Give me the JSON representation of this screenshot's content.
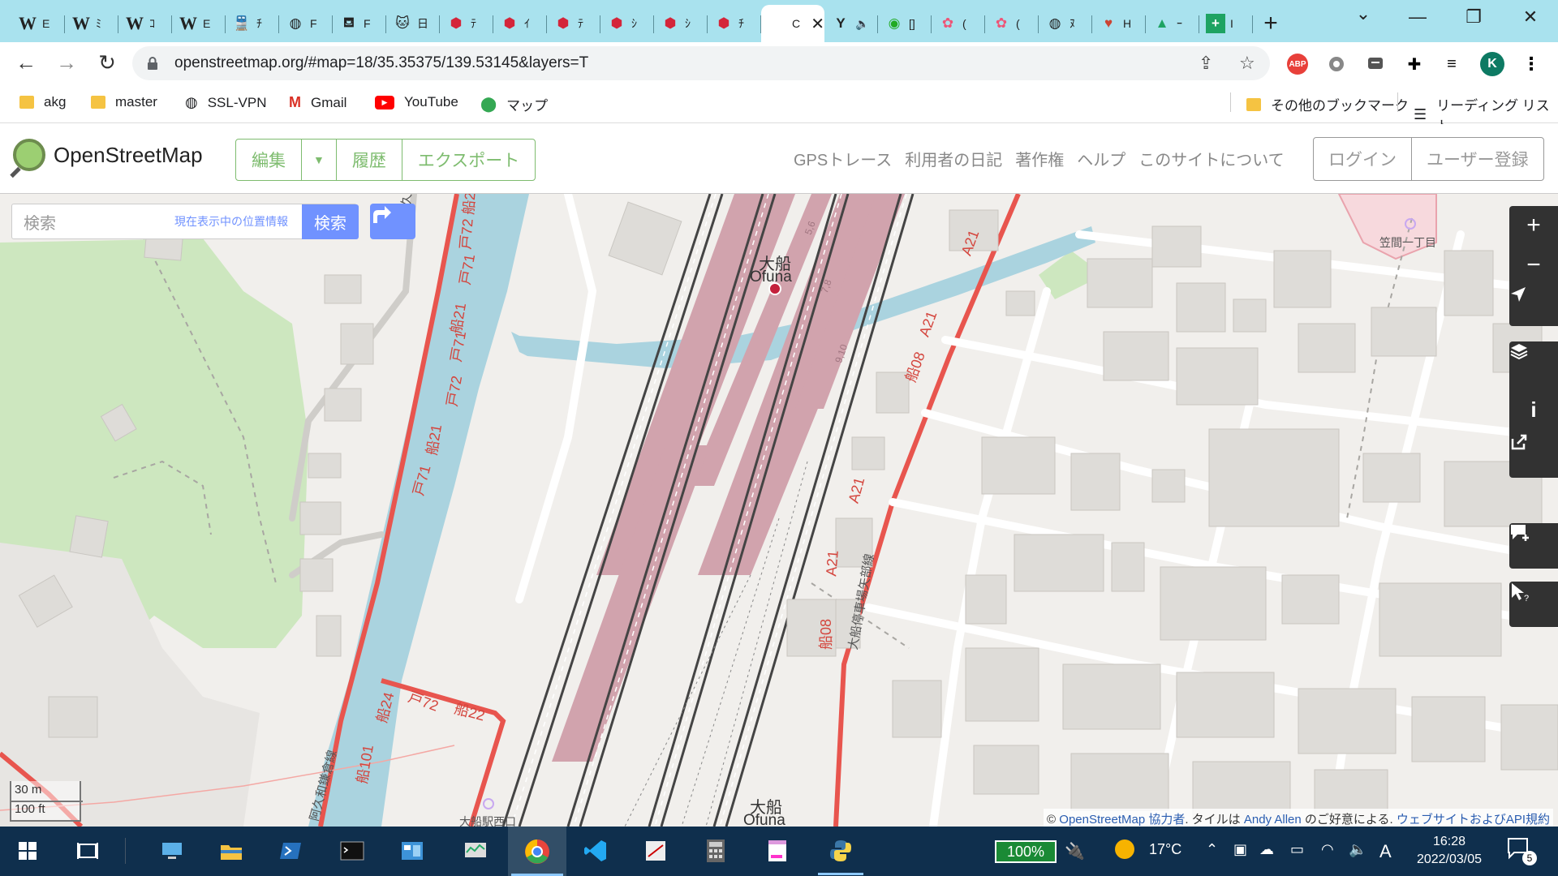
{
  "tabs": [
    {
      "icon": "wikipedia-icon",
      "glyph": "W",
      "label": "E"
    },
    {
      "icon": "wikipedia-icon",
      "glyph": "W",
      "label": "ﾐ"
    },
    {
      "icon": "wikipedia-icon",
      "glyph": "W",
      "label": "ｺ"
    },
    {
      "icon": "wikipedia-icon",
      "glyph": "W",
      "label": "E"
    },
    {
      "icon": "train-icon",
      "glyph": "🚆",
      "label": "ﾁ"
    },
    {
      "icon": "globe-icon",
      "glyph": "◍",
      "label": "F"
    },
    {
      "icon": "translate-icon",
      "glyph": "⛾",
      "label": "F"
    },
    {
      "icon": "cat-icon",
      "glyph": "🐱",
      "label": "日"
    },
    {
      "icon": "red-badge-icon",
      "glyph": "⬢",
      "label": "ﾃ"
    },
    {
      "icon": "red-badge-icon",
      "glyph": "⬢",
      "label": "ｲ"
    },
    {
      "icon": "red-badge-icon",
      "glyph": "⬢",
      "label": "ﾃ"
    },
    {
      "icon": "red-badge-icon",
      "glyph": "⬢",
      "label": "ｼ"
    },
    {
      "icon": "red-badge-icon",
      "glyph": "⬢",
      "label": "ｼ"
    },
    {
      "icon": "red-badge-icon",
      "glyph": "⬢",
      "label": "ﾁ"
    },
    {
      "icon": "osm-icon",
      "glyph": "",
      "label": "C",
      "active": true
    },
    {
      "icon": "youtube-icon",
      "glyph": "Y",
      "label": "🔈"
    },
    {
      "icon": "green-circle-icon",
      "glyph": "◉",
      "label": "[]"
    },
    {
      "icon": "photos-icon",
      "glyph": "✿",
      "label": "("
    },
    {
      "icon": "photos-icon",
      "glyph": "✿",
      "label": "("
    },
    {
      "icon": "globe-icon",
      "glyph": "◍",
      "label": "ﾇ"
    },
    {
      "icon": "heart-icon",
      "glyph": "♥",
      "label": "H"
    },
    {
      "icon": "drive-icon",
      "glyph": "▲",
      "label": "ｰ"
    },
    {
      "icon": "plus-green-icon",
      "glyph": "+",
      "label": "I"
    }
  ],
  "window": {
    "minimize": "—",
    "maximize": "❐",
    "close": "✕",
    "chevron": "⌄",
    "newtab": "+"
  },
  "address": {
    "url": "openstreetmap.org/#map=18/35.35375/139.53145&layers=T"
  },
  "bookmarks": [
    {
      "icon": "folder-icon",
      "label": "akg"
    },
    {
      "icon": "folder-icon",
      "label": "master"
    },
    {
      "icon": "globe-icon",
      "label": "SSL-VPN"
    },
    {
      "icon": "gmail-icon",
      "label": "Gmail"
    },
    {
      "icon": "youtube-icon",
      "label": "YouTube"
    },
    {
      "icon": "maps-icon",
      "label": "マップ"
    }
  ],
  "bookmarks_right": {
    "other": "その他のブックマーク",
    "reading": "リーディング リスト"
  },
  "osm": {
    "logo_text": "OpenStreetMap",
    "edit": "編集",
    "history": "履歴",
    "export": "エクスポート",
    "nav": [
      "GPSトレース",
      "利用者の日記",
      "著作権",
      "ヘルプ",
      "このサイトについて"
    ],
    "login": "ログイン",
    "signup": "ユーザー登録",
    "search_placeholder": "検索",
    "where_am_i": "現在表示中の位置情報",
    "search_button": "検索"
  },
  "map_labels": {
    "station_ja": "大船",
    "station_en": "Ofuna",
    "station_ja_bottom": "大船",
    "station_en_bottom": "Ofuna",
    "kasama": "笠間一丁目",
    "ofuna_west": "大船駅西口",
    "route_a21": "A21",
    "route_funa08": "船08",
    "route_funa21": "船21",
    "route_to71": "戸71",
    "route_to72": "戸72",
    "route_funa22": "船22",
    "route_funa24": "船24",
    "route_funa101": "船101",
    "route_funa2": "船2",
    "route_to_a": "戸72 船2",
    "kamakura_line": "阿久和鎌倉線",
    "ofuna_teisha": "大船停車場矢部線",
    "platform_56": "5,6",
    "platform_78": "7,8",
    "platform_910": "9,10",
    "platform_1": "1"
  },
  "scale": {
    "metric": "30 m",
    "imperial": "100 ft"
  },
  "attribution": {
    "prefix": "© ",
    "osm": "OpenStreetMap 協力者",
    "mid": ". タイルは ",
    "author": "Andy Allen",
    "mid2": " のご好意による. ",
    "terms": "ウェブサイトおよびAPI規約"
  },
  "taskbar": {
    "battery": "100%",
    "temp": "17°C",
    "ime": "A",
    "time": "16:28",
    "date": "2022/03/05",
    "notifications": "5"
  },
  "colors": {
    "osm_green": "#7ebc6f",
    "osm_blue": "#7092ff",
    "tab_bg": "#a9e2ee",
    "taskbar": "#0f2f4d",
    "route_red": "#e8554e",
    "water": "#aad3df",
    "platform": "#d1a3ad"
  }
}
